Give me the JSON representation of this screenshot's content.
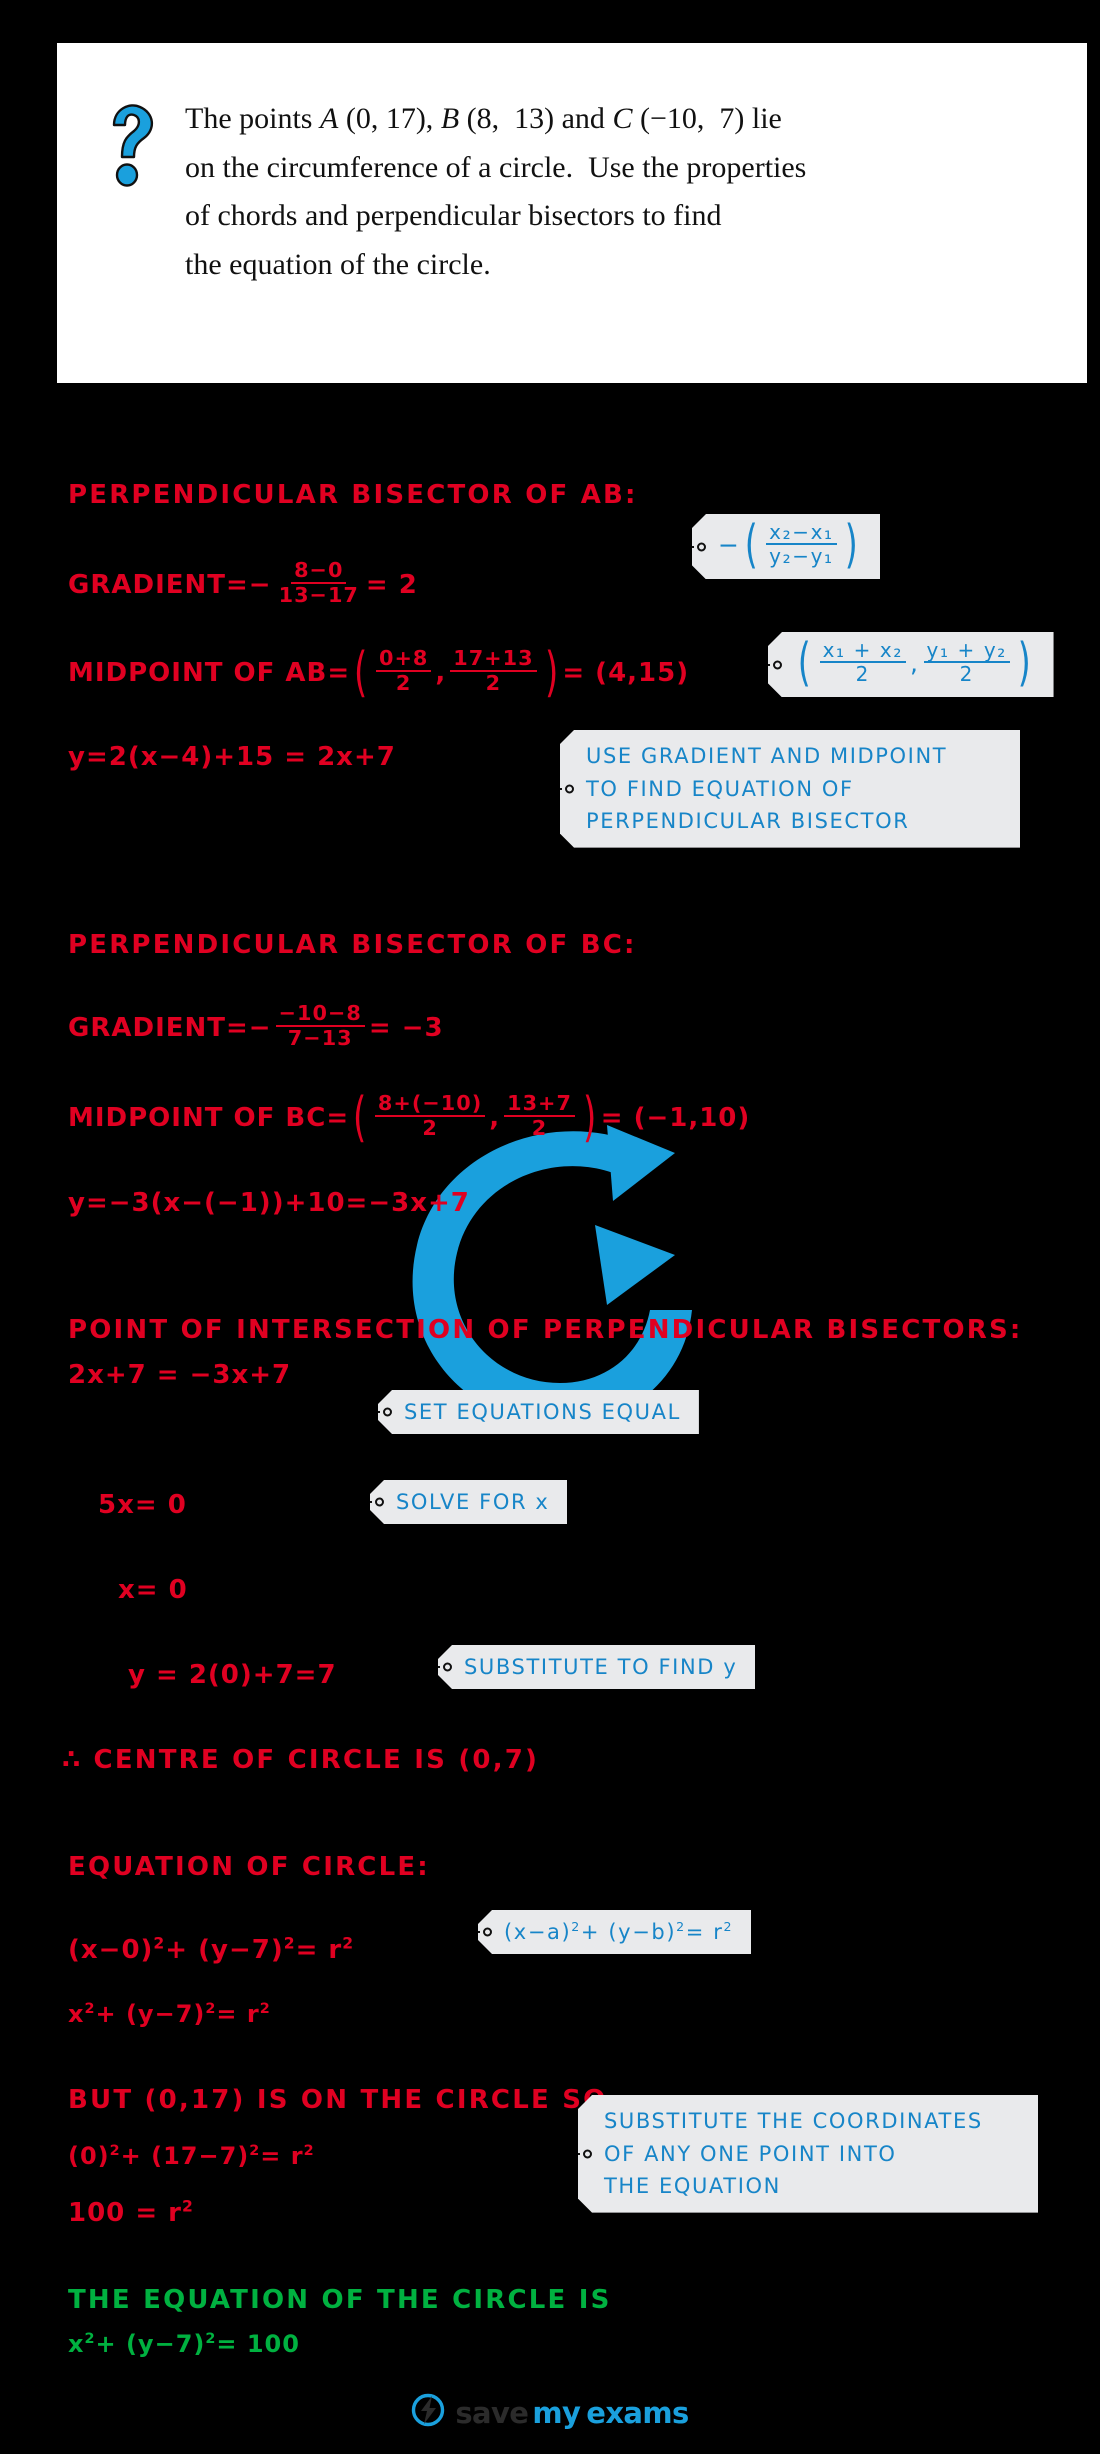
{
  "question": {
    "icon": "question-mark-icon",
    "lines": [
      "The points A (0, 17), B (8,  13) and C (−10,  7) lie",
      "on the circumference of a circle.  Use the properties",
      "of chords and perpendicular bisectors to find",
      "the equation of the circle."
    ]
  },
  "colors": {
    "background": "#000000",
    "working_red": "#e00021",
    "answer_green": "#00b140",
    "callout_blue": "#1785c8",
    "callout_bg": "#e9eaec",
    "watermark_blue": "#1aa0dd",
    "card_white": "#ffffff"
  },
  "working": {
    "s1_heading": "PERPENDICULAR   BISECTOR   OF   AB:",
    "s1_gradient_label": "GRADIENT",
    "s1_gradient_eq": "=",
    "s1_gradient_minus": "−",
    "s1_gradient_num": "8−0",
    "s1_gradient_den": "13−17",
    "s1_gradient_result": "= 2",
    "s1_midpoint_label": "MIDPOINT  OF  AB",
    "s1_midpoint_eq": "=",
    "s1_mid_num_x": "0+8",
    "s1_mid_den_x": "2",
    "s1_mid_num_y": "17+13",
    "s1_mid_den_y": "2",
    "s1_midpoint_result": "= (4,15)",
    "s1_line_eq": "y=2(x−4)+15 = 2x+7",
    "s2_heading": "PERPENDICULAR   BISECTOR   OF   BC:",
    "s2_gradient_label": "GRADIENT",
    "s2_gradient_eq": "=",
    "s2_gradient_minus": "−",
    "s2_gradient_num": "−10−8",
    "s2_gradient_den": "7−13",
    "s2_gradient_result": "= −3",
    "s2_midpoint_label": "MIDPOINT  OF  BC",
    "s2_midpoint_eq": "=",
    "s2_mid_num_x": "8+(−10)",
    "s2_mid_den_x": "2",
    "s2_mid_num_y": "13+7",
    "s2_mid_den_y": "2",
    "s2_midpoint_result": "= (−1,10)",
    "s2_line_eq": "y=−3(x−(−1))+10=−3x+7",
    "s3_heading": "POINT  OF  INTERSECTION   OF   PERPENDICULAR   BISECTORS:",
    "s3_step1": "2x+7 = −3x+7",
    "s3_step2": "5x= 0",
    "s3_step3": "x= 0",
    "s3_step4": "y = 2(0)+7=7",
    "s3_centre": "∴ CENTRE  OF  CIRCLE  IS  (0,7)",
    "s4_heading": "EQUATION  OF  CIRCLE:",
    "s4_line1_a": "(x−0)",
    "s4_line1_b": "+ (y−7)",
    "s4_line1_c": "= r",
    "s4_line2_a": "x",
    "s4_line2_b": "+ (y−7)",
    "s4_line2_c": "= r",
    "s5_heading": "BUT  (0,17)  IS  ON  THE  CIRCLE   SO",
    "s5_line1_a": "(0)",
    "s5_line1_b": "+ (17−7)",
    "s5_line1_c": "= r",
    "s5_line2_a": "100 = r",
    "answer_line1": "THE   EQUATION   OF  THE  CIRCLE  IS",
    "answer_line2_a": "x",
    "answer_line2_b": "+ (y−7)",
    "answer_line2_c": "= 100",
    "power2": "2"
  },
  "callouts": [
    {
      "id": "gradient-formula",
      "type": "math",
      "minus": "−",
      "num": "x₂−x₁",
      "den": "y₂−y₁"
    },
    {
      "id": "midpoint-formula",
      "type": "math",
      "num_x": "x₁ + x₂",
      "den_x": "2",
      "num_y": "y₁ + y₂",
      "den_y": "2",
      "comma": ","
    },
    {
      "id": "use-gradient-midpoint",
      "type": "text",
      "lines": [
        "USE   GRADIENT   AND   MIDPOINT",
        "TO   FIND   EQUATION   OF",
        "PERPENDICULAR    BISECTOR"
      ]
    },
    {
      "id": "set-equations-equal",
      "type": "text",
      "lines": [
        "SET   EQUATIONS   EQUAL"
      ]
    },
    {
      "id": "solve-for-x",
      "type": "text",
      "lines": [
        "SOLVE   FOR   x"
      ]
    },
    {
      "id": "substitute-to-find-y",
      "type": "text",
      "lines": [
        "SUBSTITUTE   TO   FIND   y"
      ]
    },
    {
      "id": "circle-equation-formula",
      "type": "math",
      "text_a": "(x−a)",
      "text_b": "+ (y−b)",
      "text_c": "= r"
    },
    {
      "id": "substitute-coordinates",
      "type": "text",
      "lines": [
        "SUBSTITUTE   THE   COORDINATES",
        "OF   ANY   ONE   POINT   INTO",
        "THE   EQUATION"
      ]
    }
  ],
  "footer": {
    "logo_icon": "save-my-exams-bolt-icon",
    "word_save": "save",
    "word_my": "my",
    "word_exams": "exams"
  }
}
